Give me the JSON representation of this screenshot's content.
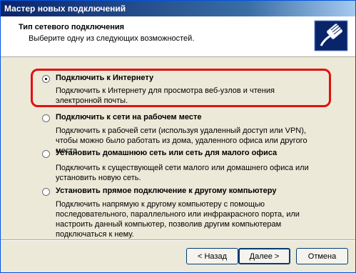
{
  "window": {
    "title": "Мастер новых подключений"
  },
  "header": {
    "title": "Тип сетевого подключения",
    "subtitle": "Выберите одну из следующих возможностей.",
    "icon": "network-cable-icon"
  },
  "options": [
    {
      "label": "Подключить к Интернету",
      "description": "Подключить к Интернету для просмотра веб-узлов и чтения электронной почты.",
      "selected": true
    },
    {
      "label": "Подключить к сети на рабочем месте",
      "description": "Подключить к рабочей сети (используя удаленный доступ или VPN), чтобы можно было работать из дома, удаленного офиса или другого места.",
      "selected": false
    },
    {
      "label": "Установить домашнюю сеть или сеть для малого офиса",
      "description": "Подключить к существующей сети малого или домашнего офиса или установить новую сеть.",
      "selected": false
    },
    {
      "label": "Установить прямое подключение к другому компьютеру",
      "description": "Подключить напрямую к другому компьютеру с помощью последовательного, параллельного или инфракрасного порта, или настроить данный компьютер, позволив другим компьютерам подключаться к нему.",
      "selected": false
    }
  ],
  "buttons": {
    "back": "< Назад",
    "next": "Далее >",
    "cancel": "Отмена"
  },
  "colors": {
    "highlight": "#e01010"
  }
}
